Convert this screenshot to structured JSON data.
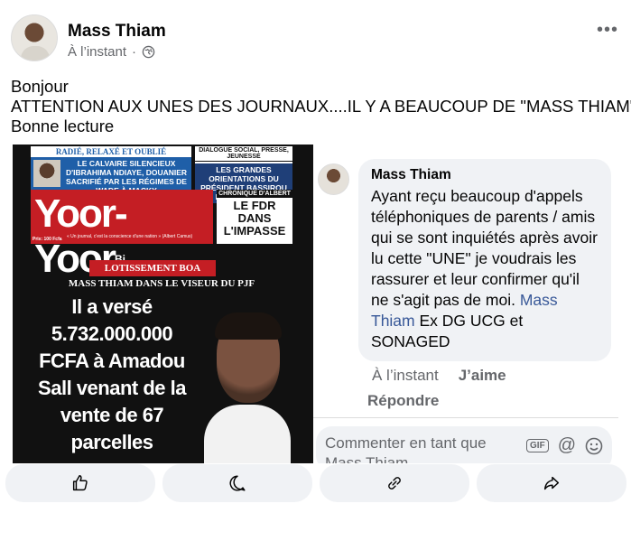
{
  "post": {
    "author": "Mass Thiam",
    "time": "À l’instant",
    "separator": "·",
    "lines": [
      "Bonjour",
      "ATTENTION AUX UNES DES JOURNAUX....IL Y A BEAUCOUP DE \"MASS THIAM\"",
      "Bonne lecture"
    ]
  },
  "newspaper": {
    "box1_head": "RADIÉ, RELAXÉ ET OUBLIÉ",
    "box1_text": "LE CALVAIRE SILENCIEUX D'IBRAHIMA NDIAYE, DOUANIER SACRIFIÉ PAR LES RÉGIMES DE WADE À MACKY",
    "box2_head": "DIALOGUE SOCIAL, PRESSE, JEUNESSE",
    "box2_text": "LES GRANDES ORIENTATIONS DU PRÉSIDENT BASSIROU DIOMAYE FAYE",
    "masthead": "Yoor-Yoor",
    "masthead_suffix": "Bi",
    "price": "Prix: 100 Fcfa",
    "tagline": "« Un journal, c'est la conscience d'une nation » (Albert Camus)",
    "chronicle_head": "CHRONIQUE D'ALBERT",
    "chronicle_text": "LE FDR DANS L'IMPASSE",
    "kicker": "LOTISSEMENT BOA",
    "subhead": "MASS THIAM DANS LE VISEUR DU PJF",
    "headline": "Il a versé 5.732.000.000 FCFA à Amadou Sall venant de la vente de 67 parcelles"
  },
  "comment": {
    "name": "Mass Thiam",
    "body": "Ayant reçu beaucoup d'appels téléphoniques de parents / amis qui se sont inquiétés après avoir lu cette \"UNE\" je voudrais les rassurer et leur confirmer qu'il ne s'agit pas de moi.",
    "mention": "Mass Thiam",
    "signature": " Ex DG UCG et SONAGED",
    "time": "À l’instant",
    "like_label": "J’aime",
    "reply_label": "Répondre",
    "input_placeholder": "Commenter en tant que Mass Thiam",
    "gif_label": "GIF"
  },
  "icons": {
    "more": "more-options-icon",
    "audience": "globe-icon",
    "like": "thumbs-up-icon",
    "comment": "comment-bubble-icon",
    "share_link": "link-icon",
    "share": "share-arrow-icon"
  },
  "colors": {
    "text": "#050505",
    "secondary": "#65676b",
    "bubble": "#f0f2f5",
    "mention": "#385898",
    "masthead_red": "#c41e24",
    "newspaper_blue": "#1f5fa8"
  }
}
